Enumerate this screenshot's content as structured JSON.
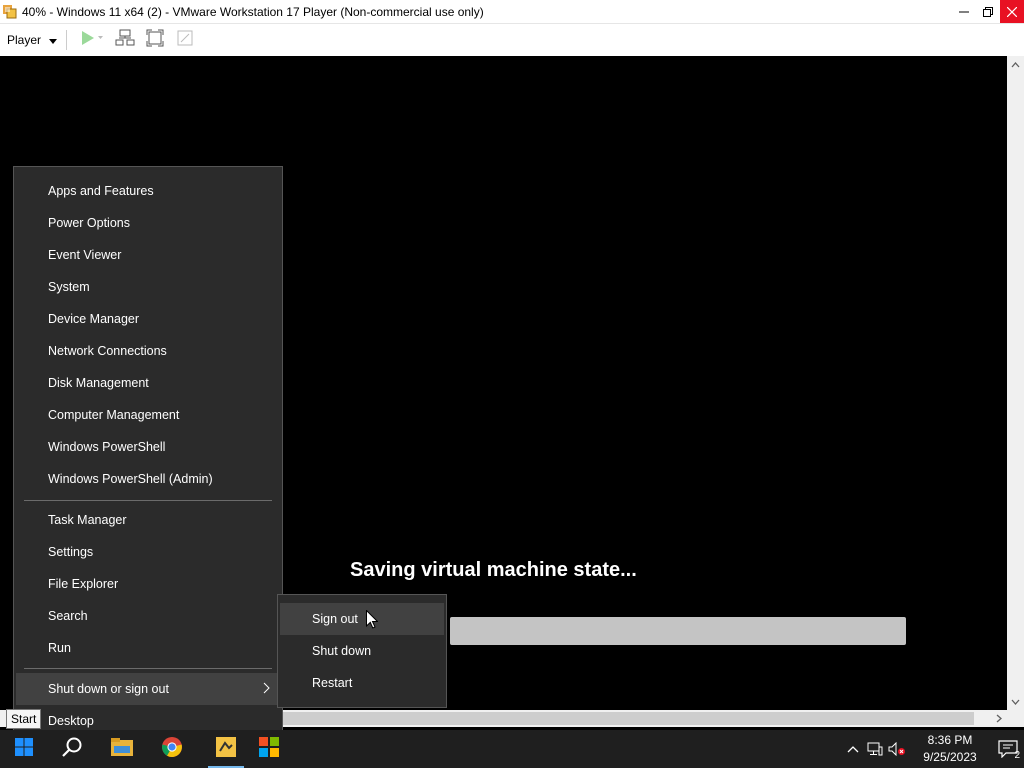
{
  "window": {
    "title": "40% - Windows 11 x64 (2) - VMware Workstation 17 Player (Non-commercial use only)"
  },
  "toolbar": {
    "player_label": "Player"
  },
  "vm": {
    "status_text": "Saving virtual machine state...",
    "progress": 0.82
  },
  "winx_menu": {
    "group1": [
      "Apps and Features",
      "Power Options",
      "Event Viewer",
      "System",
      "Device Manager",
      "Network Connections",
      "Disk Management",
      "Computer Management",
      "Windows PowerShell",
      "Windows PowerShell (Admin)"
    ],
    "group2": [
      "Task Manager",
      "Settings",
      "File Explorer",
      "Search",
      "Run"
    ],
    "shutdown_label": "Shut down or sign out",
    "desktop_label": "Desktop"
  },
  "submenu": {
    "items": [
      "Sign out",
      "Shut down",
      "Restart"
    ]
  },
  "tooltip": {
    "text": "Start"
  },
  "taskbar": {
    "time": "8:36 PM",
    "date": "9/25/2023",
    "notification_count": "2"
  },
  "colors": {
    "accent": "#76b9ed",
    "menu_bg": "#2b2b2b",
    "highlight": "#414141"
  }
}
